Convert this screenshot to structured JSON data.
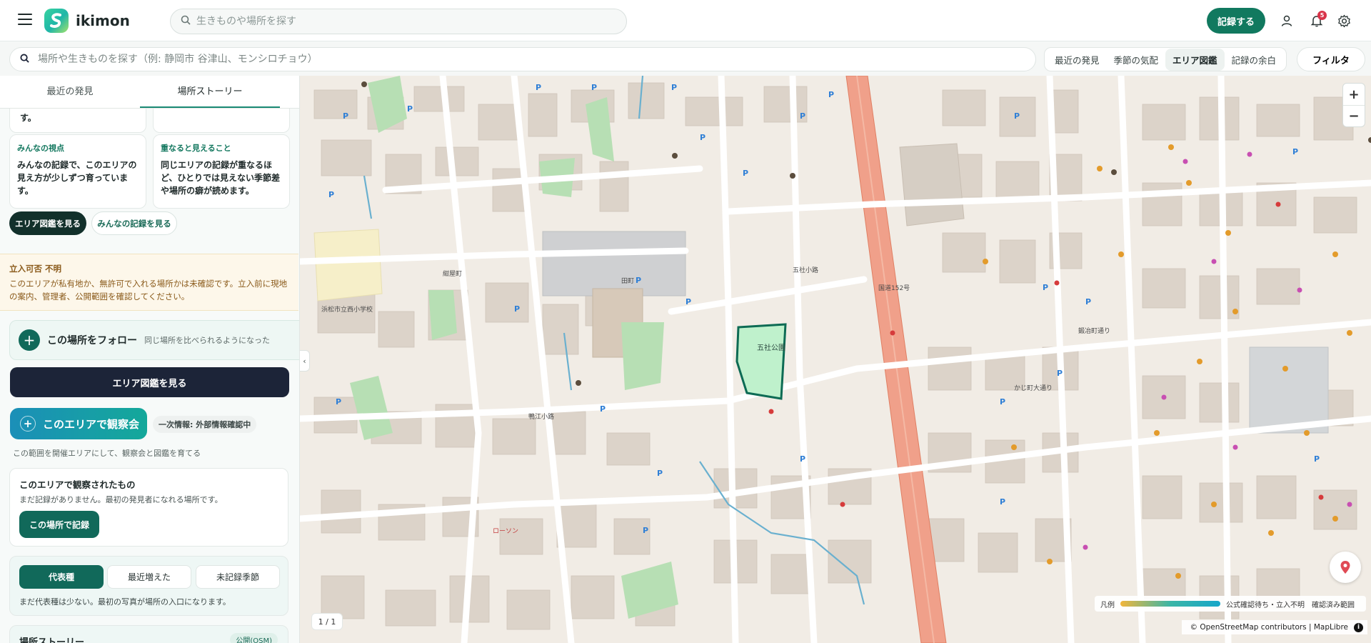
{
  "header": {
    "brand": "ikimon",
    "search_placeholder": "生きものや場所を探す",
    "record_label": "記録する",
    "notification_count": "5"
  },
  "subbar": {
    "search_placeholder": "場所や生きものを探す（例: 静岡市 谷津山、モンシロチョウ）",
    "segments": [
      "最近の発見",
      "季節の気配",
      "エリア図鑑",
      "記録の余白"
    ],
    "active_segment": "エリア図鑑",
    "filter_label": "フィルタ"
  },
  "sidebar": {
    "tabs": [
      "最近の発見",
      "場所ストーリー"
    ],
    "active_tab": "場所ストーリー",
    "top_fragment": "す。",
    "cards": [
      {
        "label": "みんなの視点",
        "text": "みんなの記録で、このエリアの見え方が少しずつ育っています。"
      },
      {
        "label": "重なると見えること",
        "text": "同じエリアの記録が重なるほど、ひとりでは見えない季節差や場所の癖が読めます。"
      }
    ],
    "btn_area_book": "エリア図鑑を見る",
    "btn_all_records": "みんなの記録を見る",
    "warning": {
      "title": "立入可否 不明",
      "text": "このエリアが私有地か、無許可で入れる場所かは未確認です。立入前に現地の案内、管理者、公開範囲を確認してください。"
    },
    "follow": {
      "title": "この場所をフォロー",
      "sub": "同じ場所を比べられるようになった"
    },
    "btn_area_book_big": "エリア図鑑を見る",
    "btn_observe": "このエリアで観察会",
    "info_chip": "一次情報: 外部情報確認中",
    "observe_note": "この範囲を開催エリアにして、観察会と図鑑を育てる",
    "observed": {
      "title": "このエリアで観察されたもの",
      "text": "まだ記録がありません。最初の発見者になれる場所です。",
      "btn": "この場所で記録"
    },
    "tabs2": [
      "代表種",
      "最近増えた",
      "未記録季節"
    ],
    "tabs2_note": "まだ代表種は少ない。最初の写真が場所の入口になります。",
    "story_title": "場所ストーリー",
    "story_badge": "公開(OSM)"
  },
  "map": {
    "park_label": "五社公園",
    "zoom_in": "+",
    "zoom_out": "−",
    "page_indicator": "1 / 1",
    "legend": {
      "label": "凡例",
      "status": "公式確認待ち・立入不明",
      "confirmed": "確認済み範囲"
    },
    "attribution": "© OpenStreetMap contributors | MapLibre",
    "labels": [
      "五社小路",
      "鴨江小路",
      "田町",
      "かじ町大通り",
      "浜松市立西小学校",
      "国道152号",
      "鍛冶町通り",
      "紺屋町",
      "ローソン"
    ]
  }
}
